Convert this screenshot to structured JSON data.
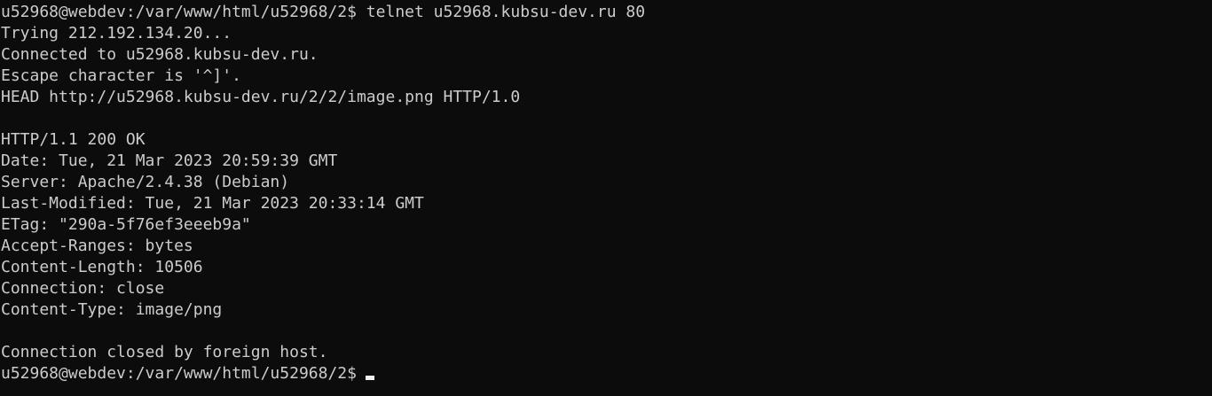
{
  "colors": {
    "background": "#0c0c0c",
    "foreground": "#cccccc",
    "cursor": "#f2f2f2"
  },
  "terminal": {
    "lines": [
      "u52968@webdev:/var/www/html/u52968/2$ telnet u52968.kubsu-dev.ru 80",
      "Trying 212.192.134.20...",
      "Connected to u52968.kubsu-dev.ru.",
      "Escape character is '^]'.",
      "HEAD http://u52968.kubsu-dev.ru/2/2/image.png HTTP/1.0",
      "",
      "HTTP/1.1 200 OK",
      "Date: Tue, 21 Mar 2023 20:59:39 GMT",
      "Server: Apache/2.4.38 (Debian)",
      "Last-Modified: Tue, 21 Mar 2023 20:33:14 GMT",
      "ETag: \"290a-5f76ef3eeeb9a\"",
      "Accept-Ranges: bytes",
      "Content-Length: 10506",
      "Connection: close",
      "Content-Type: image/png",
      "",
      "Connection closed by foreign host."
    ],
    "prompt": "u52968@webdev:/var/www/html/u52968/2$"
  }
}
